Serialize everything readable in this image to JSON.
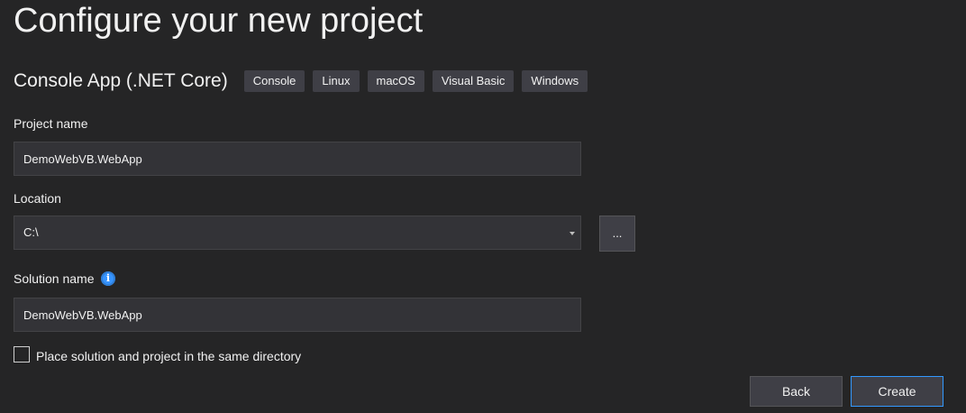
{
  "title": "Configure your new project",
  "template": {
    "name": "Console App (.NET Core)",
    "tags": [
      "Console",
      "Linux",
      "macOS",
      "Visual Basic",
      "Windows"
    ]
  },
  "project_name": {
    "label": "Project name",
    "value": "DemoWebVB.WebApp"
  },
  "location": {
    "label": "Location",
    "value": "C:\\",
    "browse_label": "..."
  },
  "solution_name": {
    "label": "Solution name",
    "value": "DemoWebVB.WebApp",
    "info_icon": "info-icon"
  },
  "same_directory": {
    "label": "Place solution and project in the same directory",
    "checked": false
  },
  "buttons": {
    "back": "Back",
    "create": "Create"
  },
  "colors": {
    "background": "#252526",
    "field": "#333337",
    "tag": "#3f3f46",
    "accent": "#3399ff",
    "info": "#3794ff"
  }
}
